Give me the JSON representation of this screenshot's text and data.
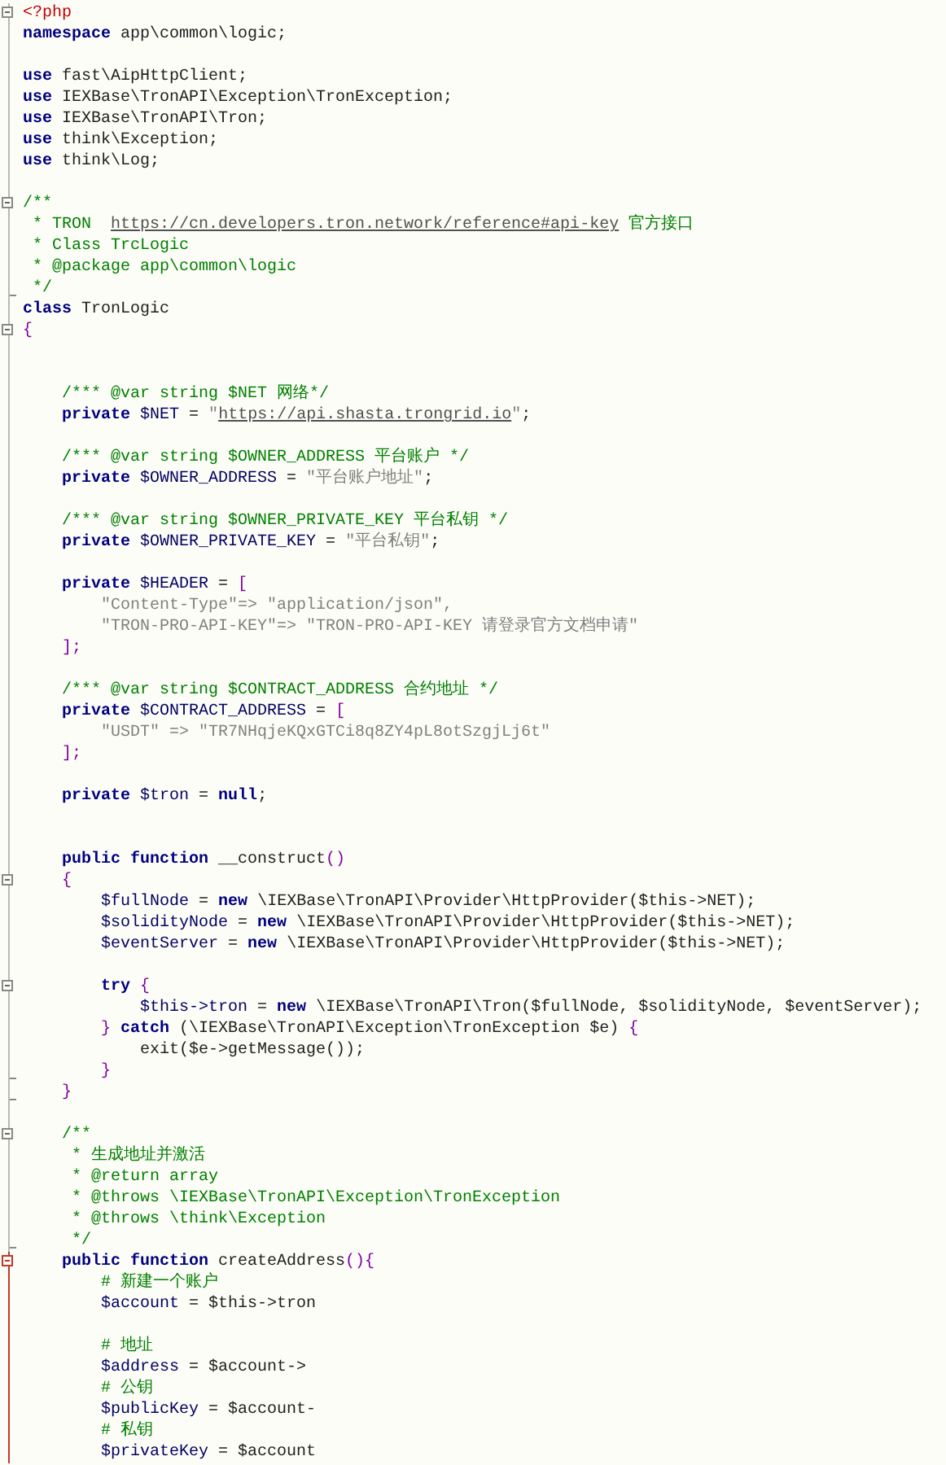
{
  "editor": {
    "lines": [
      {
        "kind": "start",
        "tokens": [
          {
            "kind": "tag",
            "text": "<?php"
          }
        ]
      },
      {
        "kind": "plain",
        "tokens": [
          {
            "kind": "kw",
            "text": "namespace"
          },
          {
            "kind": "text",
            "text": " app\\common\\logic;"
          }
        ]
      },
      {
        "kind": "plain"
      },
      {
        "kind": "plain",
        "tokens": [
          {
            "kind": "kw",
            "text": "use"
          },
          {
            "kind": "text",
            "text": " fast\\AipHttpClient;"
          }
        ]
      },
      {
        "kind": "plain",
        "tokens": [
          {
            "kind": "kw",
            "text": "use"
          },
          {
            "kind": "text",
            "text": " IEXBase\\TronAPI\\Exception\\TronException;"
          }
        ]
      },
      {
        "kind": "plain",
        "tokens": [
          {
            "kind": "kw",
            "text": "use"
          },
          {
            "kind": "text",
            "text": " IEXBase\\TronAPI\\Tron;"
          }
        ]
      },
      {
        "kind": "plain",
        "tokens": [
          {
            "kind": "kw",
            "text": "use"
          },
          {
            "kind": "text",
            "text": " think\\Exception;"
          }
        ]
      },
      {
        "kind": "plain",
        "tokens": [
          {
            "kind": "kw",
            "text": "use"
          },
          {
            "kind": "text",
            "text": " think\\Log;"
          }
        ]
      },
      {
        "kind": "plain"
      },
      {
        "kind": "start",
        "tokens": [
          {
            "kind": "comment",
            "text": "/**"
          }
        ]
      },
      {
        "kind": "plain",
        "tokens": [
          {
            "kind": "comment",
            "text": " * TRON  "
          },
          {
            "kind": "link",
            "text": "https://cn.developers.tron.network/reference#api-key"
          },
          {
            "kind": "comment",
            "text": " 官方接口"
          }
        ]
      },
      {
        "kind": "plain",
        "tokens": [
          {
            "kind": "comment",
            "text": " * Class TrcLogic"
          }
        ]
      },
      {
        "kind": "plain",
        "tokens": [
          {
            "kind": "comment",
            "text": " * @package app\\common\\logic"
          }
        ]
      },
      {
        "kind": "end",
        "tokens": [
          {
            "kind": "comment",
            "text": " */"
          }
        ]
      },
      {
        "kind": "plain",
        "tokens": [
          {
            "kind": "kw",
            "text": "class"
          },
          {
            "kind": "text",
            "text": " TronLogic"
          }
        ]
      },
      {
        "kind": "start",
        "tokens": [
          {
            "kind": "punct",
            "text": "{"
          }
        ]
      },
      {
        "kind": "plain"
      },
      {
        "kind": "plain"
      },
      {
        "kind": "plain",
        "tokens": [
          {
            "kind": "comment",
            "text": "    /*** @var string $NET 网络*/"
          }
        ]
      },
      {
        "kind": "plain",
        "tokens": [
          {
            "kind": "kw",
            "text": "    private"
          },
          {
            "kind": "var",
            "text": " $NET"
          },
          {
            "kind": "text",
            "text": " = "
          },
          {
            "kind": "str",
            "text": "\""
          },
          {
            "kind": "link",
            "text": "https://api.shasta.trongrid.io"
          },
          {
            "kind": "str",
            "text": "\""
          },
          {
            "kind": "text",
            "text": ";"
          }
        ]
      },
      {
        "kind": "plain"
      },
      {
        "kind": "plain",
        "tokens": [
          {
            "kind": "comment",
            "text": "    /*** @var string $OWNER_ADDRESS 平台账户 */"
          }
        ]
      },
      {
        "kind": "plain",
        "tokens": [
          {
            "kind": "kw",
            "text": "    private"
          },
          {
            "kind": "var",
            "text": " $OWNER_ADDRESS"
          },
          {
            "kind": "text",
            "text": " = "
          },
          {
            "kind": "str",
            "text": "\"平台账户地址\""
          },
          {
            "kind": "text",
            "text": ";"
          }
        ]
      },
      {
        "kind": "plain"
      },
      {
        "kind": "plain",
        "tokens": [
          {
            "kind": "comment",
            "text": "    /*** @var string $OWNER_PRIVATE_KEY 平台私钥 */"
          }
        ]
      },
      {
        "kind": "plain",
        "tokens": [
          {
            "kind": "kw",
            "text": "    private"
          },
          {
            "kind": "var",
            "text": " $OWNER_PRIVATE_KEY"
          },
          {
            "kind": "text",
            "text": " = "
          },
          {
            "kind": "str",
            "text": "\"平台私钥\""
          },
          {
            "kind": "text",
            "text": ";"
          }
        ]
      },
      {
        "kind": "plain"
      },
      {
        "kind": "plain",
        "tokens": [
          {
            "kind": "kw",
            "text": "    private"
          },
          {
            "kind": "var",
            "text": " $HEADER"
          },
          {
            "kind": "text",
            "text": " = "
          },
          {
            "kind": "punct",
            "text": "["
          }
        ]
      },
      {
        "kind": "plain",
        "tokens": [
          {
            "kind": "str",
            "text": "        \"Content-Type\"=> \"application/json\","
          }
        ]
      },
      {
        "kind": "plain",
        "tokens": [
          {
            "kind": "str",
            "text": "        \"TRON-PRO-API-KEY\"=> \"TRON-PRO-API-KEY 请登录官方文档申请\""
          }
        ]
      },
      {
        "kind": "plain",
        "tokens": [
          {
            "kind": "punct",
            "text": "    ];"
          }
        ]
      },
      {
        "kind": "plain"
      },
      {
        "kind": "plain",
        "tokens": [
          {
            "kind": "comment",
            "text": "    /*** @var string $CONTRACT_ADDRESS 合约地址 */"
          }
        ]
      },
      {
        "kind": "plain",
        "tokens": [
          {
            "kind": "kw",
            "text": "    private"
          },
          {
            "kind": "var",
            "text": " $CONTRACT_ADDRESS"
          },
          {
            "kind": "text",
            "text": " = "
          },
          {
            "kind": "punct",
            "text": "["
          }
        ]
      },
      {
        "kind": "plain",
        "tokens": [
          {
            "kind": "str",
            "text": "        \"USDT\" => \"TR7NHqjeKQxGTCi8q8ZY4pL8otSzgjLj6t\""
          }
        ]
      },
      {
        "kind": "plain",
        "tokens": [
          {
            "kind": "punct",
            "text": "    ];"
          }
        ]
      },
      {
        "kind": "plain"
      },
      {
        "kind": "plain",
        "tokens": [
          {
            "kind": "kw",
            "text": "    private"
          },
          {
            "kind": "var",
            "text": " $tron"
          },
          {
            "kind": "text",
            "text": " = "
          },
          {
            "kind": "kw",
            "text": "null"
          },
          {
            "kind": "text",
            "text": ";"
          }
        ]
      },
      {
        "kind": "plain"
      },
      {
        "kind": "plain"
      },
      {
        "kind": "plain",
        "tokens": [
          {
            "kind": "kw",
            "text": "    public function"
          },
          {
            "kind": "text",
            "text": " __construct"
          },
          {
            "kind": "punct",
            "text": "()"
          }
        ]
      },
      {
        "kind": "start",
        "tokens": [
          {
            "kind": "punct",
            "text": "    {"
          }
        ]
      },
      {
        "kind": "plain",
        "tokens": [
          {
            "kind": "var",
            "text": "        $fullNode"
          },
          {
            "kind": "text",
            "text": " = "
          },
          {
            "kind": "kw",
            "text": "new"
          },
          {
            "kind": "text",
            "text": " \\IEXBase\\TronAPI\\Provider\\HttpProvider($this->NET);"
          }
        ]
      },
      {
        "kind": "plain",
        "tokens": [
          {
            "kind": "var",
            "text": "        $solidityNode"
          },
          {
            "kind": "text",
            "text": " = "
          },
          {
            "kind": "kw",
            "text": "new"
          },
          {
            "kind": "text",
            "text": " \\IEXBase\\TronAPI\\Provider\\HttpProvider($this->NET);"
          }
        ]
      },
      {
        "kind": "plain",
        "tokens": [
          {
            "kind": "var",
            "text": "        $eventServer"
          },
          {
            "kind": "text",
            "text": " = "
          },
          {
            "kind": "kw",
            "text": "new"
          },
          {
            "kind": "text",
            "text": " \\IEXBase\\TronAPI\\Provider\\HttpProvider($this->NET);"
          }
        ]
      },
      {
        "kind": "plain"
      },
      {
        "kind": "start",
        "tokens": [
          {
            "kind": "kw",
            "text": "        try"
          },
          {
            "kind": "punct",
            "text": " {"
          }
        ]
      },
      {
        "kind": "plain",
        "tokens": [
          {
            "kind": "var",
            "text": "            $this->tron"
          },
          {
            "kind": "text",
            "text": " = "
          },
          {
            "kind": "kw",
            "text": "new"
          },
          {
            "kind": "text",
            "text": " \\IEXBase\\TronAPI\\Tron($fullNode, $solidityNode, $eventServer);"
          }
        ]
      },
      {
        "kind": "plain",
        "tokens": [
          {
            "kind": "punct",
            "text": "        }"
          },
          {
            "kind": "kw",
            "text": " catch"
          },
          {
            "kind": "text",
            "text": " (\\IEXBase\\TronAPI\\Exception\\TronException $e) "
          },
          {
            "kind": "punct",
            "text": "{"
          }
        ]
      },
      {
        "kind": "plain",
        "tokens": [
          {
            "kind": "text",
            "text": "            exit($e->getMessage());"
          }
        ]
      },
      {
        "kind": "end",
        "tokens": [
          {
            "kind": "punct",
            "text": "        }"
          }
        ]
      },
      {
        "kind": "end",
        "tokens": [
          {
            "kind": "punct",
            "text": "    }"
          }
        ]
      },
      {
        "kind": "plain"
      },
      {
        "kind": "start",
        "tokens": [
          {
            "kind": "comment",
            "text": "    /**"
          }
        ]
      },
      {
        "kind": "plain",
        "tokens": [
          {
            "kind": "comment",
            "text": "     * 生成地址并激活"
          }
        ]
      },
      {
        "kind": "plain",
        "tokens": [
          {
            "kind": "comment",
            "text": "     * @return array"
          }
        ]
      },
      {
        "kind": "plain",
        "tokens": [
          {
            "kind": "comment",
            "text": "     * @throws \\IEXBase\\TronAPI\\Exception\\TronException"
          }
        ]
      },
      {
        "kind": "plain",
        "tokens": [
          {
            "kind": "comment",
            "text": "     * @throws \\think\\Exception"
          }
        ]
      },
      {
        "kind": "end",
        "tokens": [
          {
            "kind": "comment",
            "text": "     */"
          }
        ]
      },
      {
        "kind": "activestart",
        "tokens": [
          {
            "kind": "kw",
            "text": "    public function"
          },
          {
            "kind": "text",
            "text": " createAddress"
          },
          {
            "kind": "punct",
            "text": "(){"
          }
        ]
      },
      {
        "kind": "active",
        "tokens": [
          {
            "kind": "comment",
            "text": "        # 新建一个账户"
          }
        ]
      },
      {
        "kind": "active",
        "tokens": [
          {
            "kind": "var",
            "text": "        $account"
          },
          {
            "kind": "text",
            "text": " = $this->tron"
          }
        ]
      },
      {
        "kind": "active"
      },
      {
        "kind": "active",
        "tokens": [
          {
            "kind": "comment",
            "text": "        # 地址"
          }
        ]
      },
      {
        "kind": "active",
        "tokens": [
          {
            "kind": "var",
            "text": "        $address"
          },
          {
            "kind": "text",
            "text": " = $account->"
          }
        ]
      },
      {
        "kind": "active",
        "tokens": [
          {
            "kind": "comment",
            "text": "        # 公钥"
          }
        ]
      },
      {
        "kind": "active",
        "tokens": [
          {
            "kind": "var",
            "text": "        $publicKey"
          },
          {
            "kind": "text",
            "text": " = $account-"
          }
        ]
      },
      {
        "kind": "active",
        "tokens": [
          {
            "kind": "comment",
            "text": "        # 私钥"
          }
        ]
      },
      {
        "kind": "active",
        "tokens": [
          {
            "kind": "var",
            "text": "        $privateKey"
          },
          {
            "kind": "text",
            "text": " = $account"
          }
        ]
      }
    ]
  }
}
